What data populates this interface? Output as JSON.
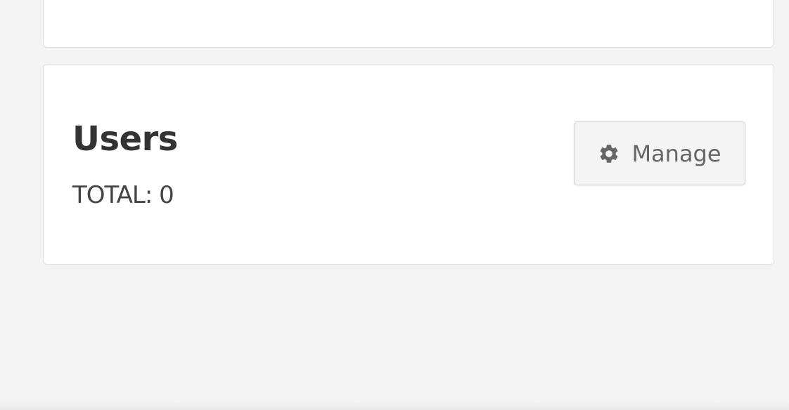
{
  "users_card": {
    "title": "Users",
    "total_label": "TOTAL: 0"
  },
  "manage_button": {
    "label": "Manage",
    "icon": "gear-icon"
  },
  "colors": {
    "background": "#f3f3f3",
    "card": "#ffffff",
    "title_text": "#333333",
    "button_bg": "#f4f4f4",
    "button_text": "#666666"
  }
}
